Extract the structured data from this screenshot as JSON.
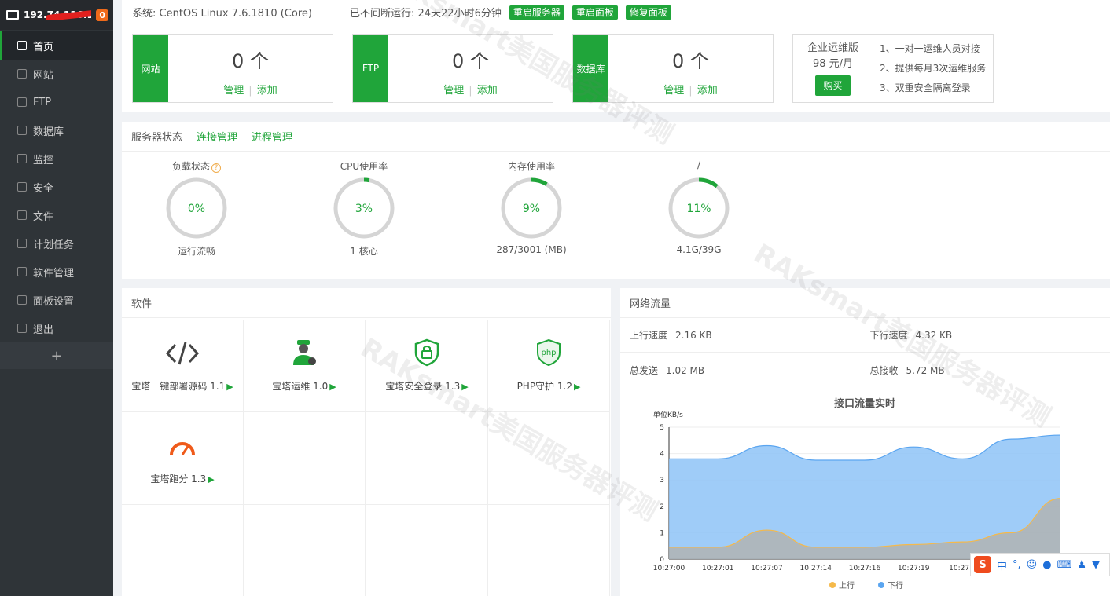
{
  "sidebar": {
    "ip": "192.74.116.117",
    "badge": "0",
    "items": [
      {
        "label": "首页",
        "icon": "home-icon"
      },
      {
        "label": "网站",
        "icon": "globe-icon"
      },
      {
        "label": "FTP",
        "icon": "ftp-icon"
      },
      {
        "label": "数据库",
        "icon": "database-icon"
      },
      {
        "label": "监控",
        "icon": "monitor-icon"
      },
      {
        "label": "安全",
        "icon": "shield-icon"
      },
      {
        "label": "文件",
        "icon": "folder-icon"
      },
      {
        "label": "计划任务",
        "icon": "calendar-icon"
      },
      {
        "label": "软件管理",
        "icon": "grid-icon"
      },
      {
        "label": "面板设置",
        "icon": "gear-icon"
      },
      {
        "label": "退出",
        "icon": "logout-icon"
      }
    ],
    "add": "+"
  },
  "topbar": {
    "system": "系统: CentOS Linux 7.6.1810 (Core)",
    "uptime": "已不间断运行: 24天22小时6分钟",
    "btn_restart_server": "重启服务器",
    "btn_restart_panel": "重启面板",
    "btn_repair_panel": "修复面板"
  },
  "stats": [
    {
      "tag": "网站",
      "count": "0 个",
      "manage": "管理",
      "add": "添加"
    },
    {
      "tag": "FTP",
      "count": "0 个",
      "manage": "管理",
      "add": "添加"
    },
    {
      "tag": "数据库",
      "count": "0 个",
      "manage": "管理",
      "add": "添加"
    }
  ],
  "enterprise": {
    "title": "企业运维版",
    "price": "98 元/月",
    "buy": "购买",
    "features": [
      "1、一对一运维人员对接",
      "2、提供每月3次运维服务",
      "3、双重安全隔离登录"
    ]
  },
  "status": {
    "title": "服务器状态",
    "link_conn": "连接管理",
    "link_proc": "进程管理",
    "gauges": [
      {
        "label": "负载状态",
        "value": "0%",
        "sub": "运行流畅",
        "pct": 0
      },
      {
        "label": "CPU使用率",
        "value": "3%",
        "sub": "1 核心",
        "pct": 3
      },
      {
        "label": "内存使用率",
        "value": "9%",
        "sub": "287/3001 (MB)",
        "pct": 9
      },
      {
        "label": "/",
        "value": "11%",
        "sub": "4.1G/39G",
        "pct": 11
      }
    ]
  },
  "software": {
    "title": "软件",
    "items": [
      {
        "name": "宝塔一键部署源码 1.1",
        "icon": "code-icon"
      },
      {
        "name": "宝塔运维 1.0",
        "icon": "ops-person-icon"
      },
      {
        "name": "宝塔安全登录 1.3",
        "icon": "lock-shield-icon"
      },
      {
        "name": "PHP守护 1.2",
        "icon": "php-shield-icon"
      },
      {
        "name": "宝塔跑分 1.3",
        "icon": "speedometer-icon"
      }
    ]
  },
  "network": {
    "title": "网络流量",
    "up_label": "上行速度",
    "up_value": "2.16 KB",
    "down_label": "下行速度",
    "down_value": "4.32 KB",
    "sent_label": "总发送",
    "sent_value": "1.02 MB",
    "recv_label": "总接收",
    "recv_value": "5.72 MB"
  },
  "chart_data": {
    "type": "area",
    "title": "接口流量实时",
    "ylabel": "单位KB/s",
    "ylim": [
      0,
      5
    ],
    "yticks": [
      "0",
      "1",
      "2",
      "3",
      "4",
      "5"
    ],
    "x": [
      "10:27:00",
      "10:27:01",
      "10:27:07",
      "10:27:14",
      "10:27:16",
      "10:27:19",
      "10:27:2"
    ],
    "series": [
      {
        "name": "上行",
        "color": "#f5b94a",
        "values": [
          0.45,
          0.45,
          1.1,
          0.45,
          0.45,
          0.55,
          0.65,
          1.0,
          2.3
        ]
      },
      {
        "name": "下行",
        "color": "#5aa5f0",
        "values": [
          3.8,
          3.8,
          4.3,
          3.75,
          3.75,
          4.25,
          3.8,
          4.55,
          4.7
        ]
      }
    ],
    "legend_position": "bottom"
  },
  "ime": {
    "brand": "S",
    "lang": "中"
  }
}
